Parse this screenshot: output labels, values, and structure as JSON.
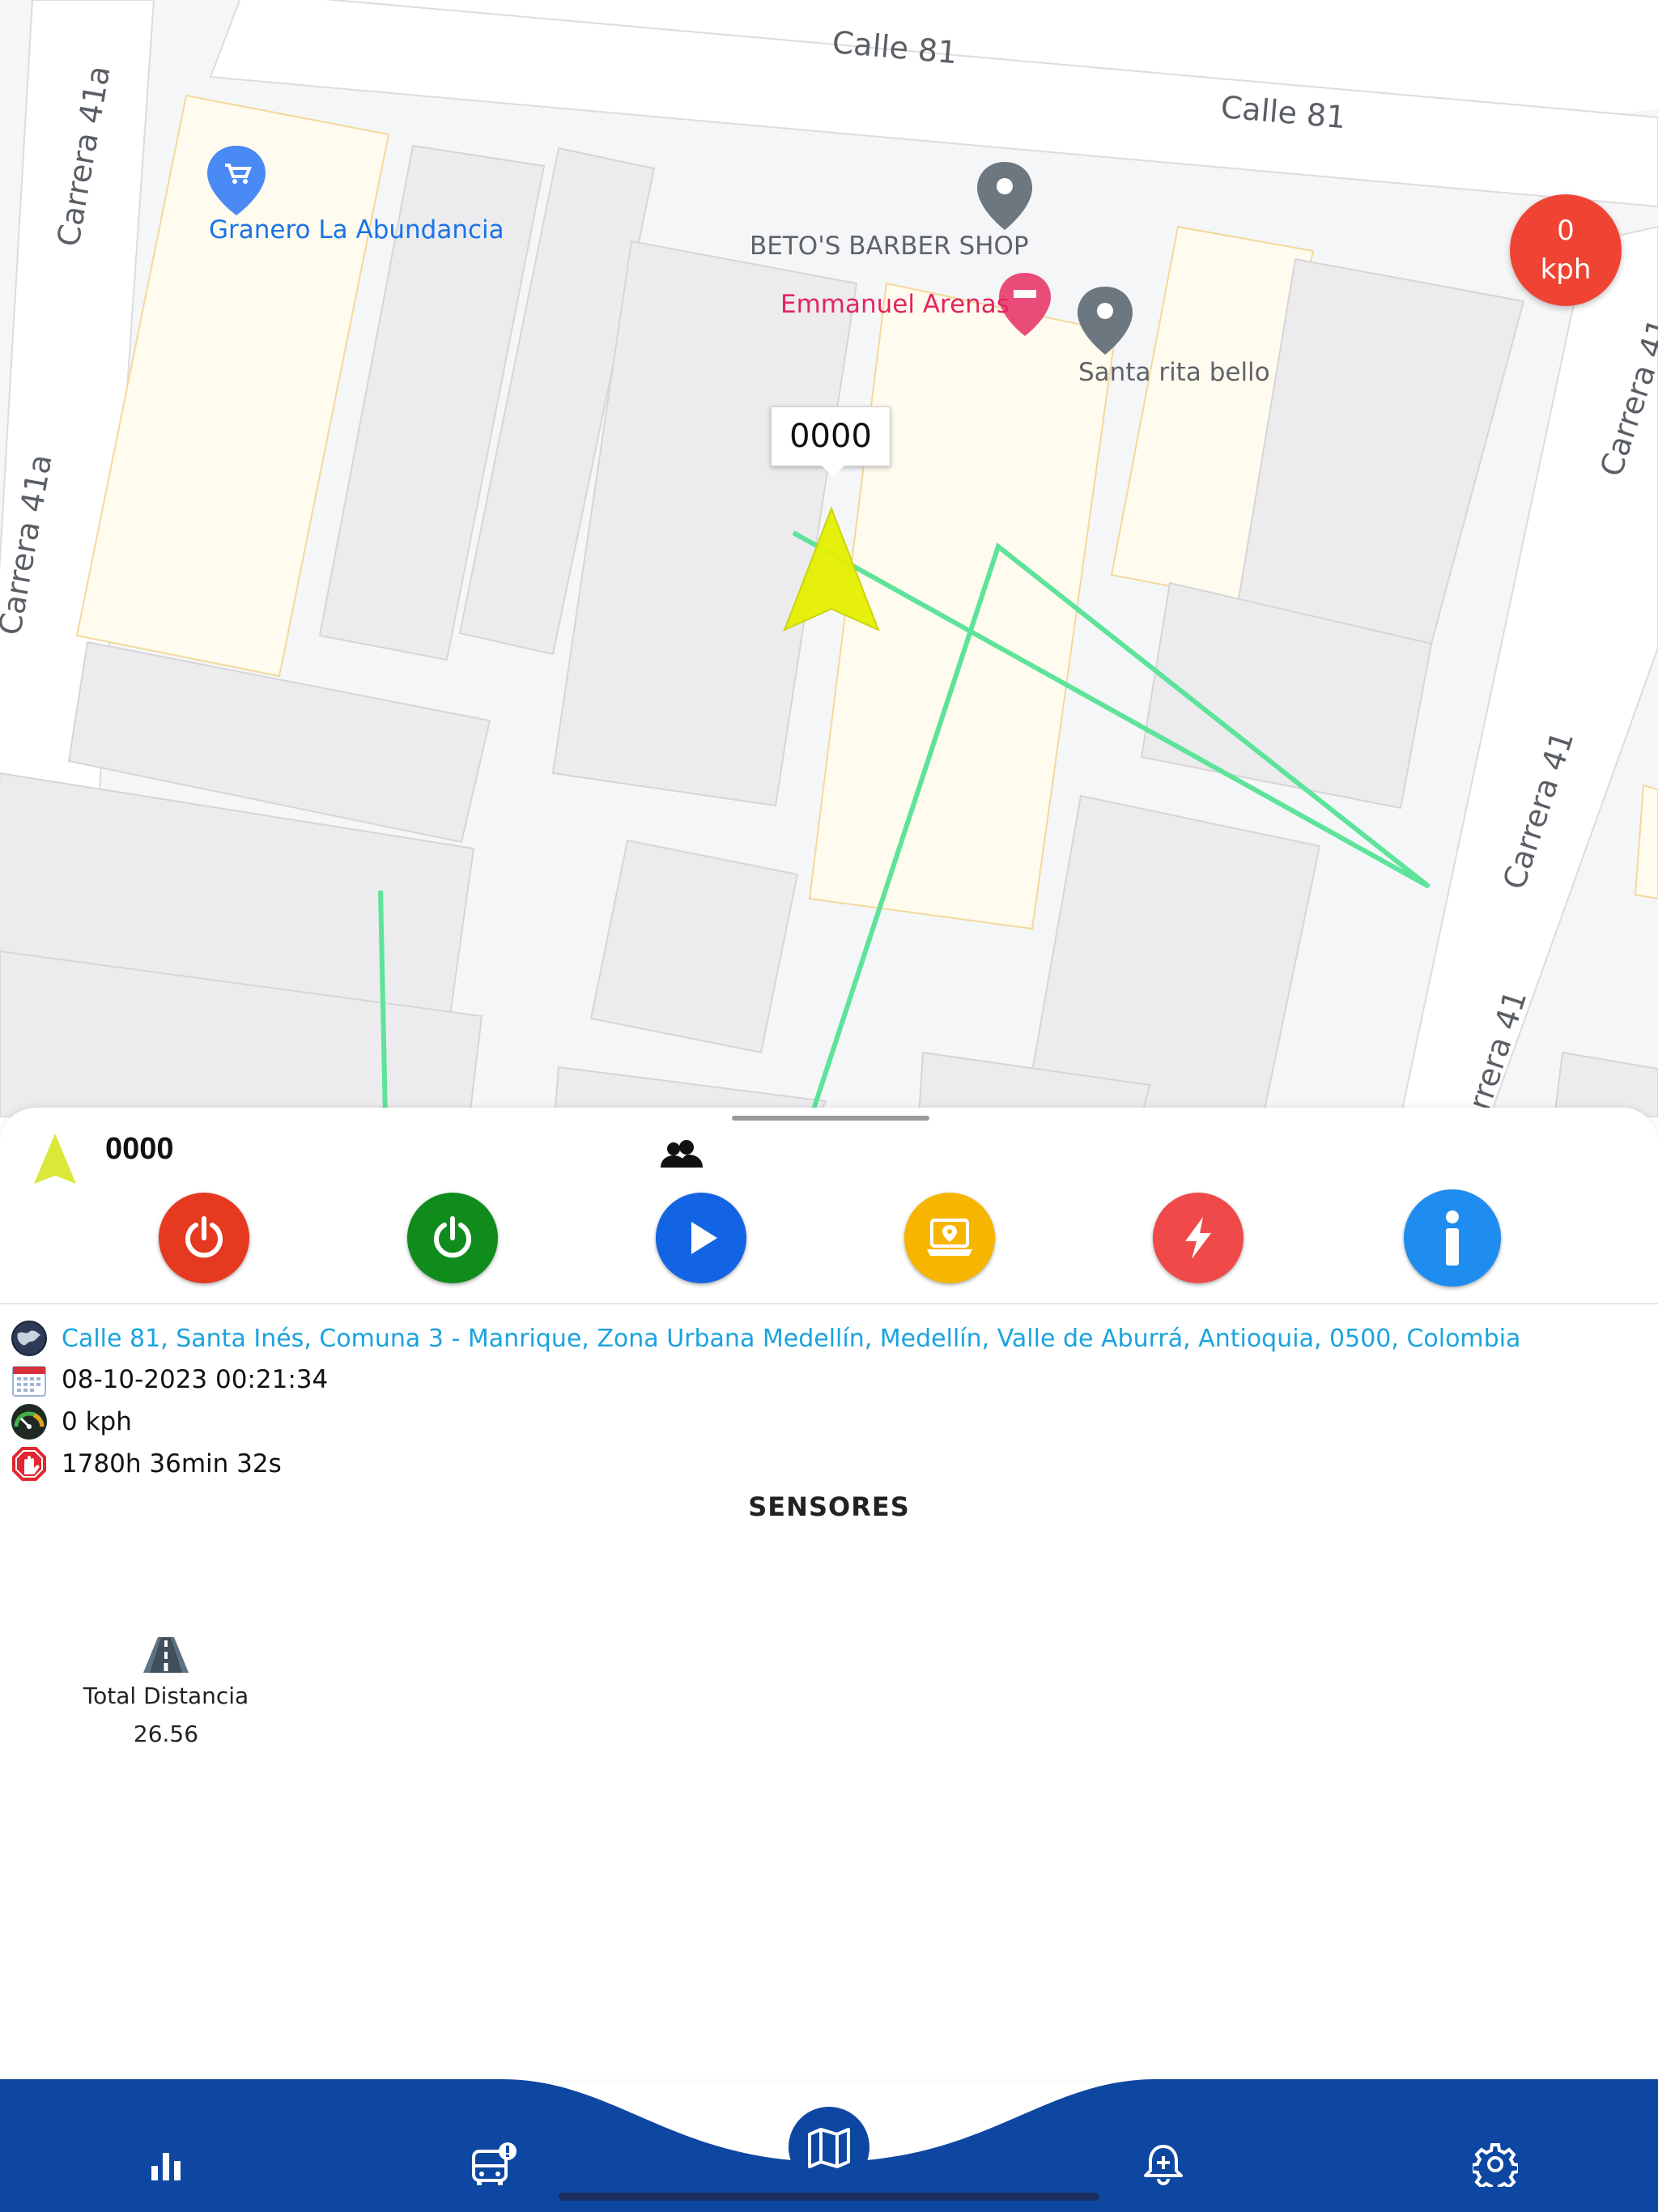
{
  "map": {
    "streets": [
      "Calle 81",
      "Calle 81",
      "Carrera 41a",
      "Carrera 41a",
      "Carrera 41",
      "Carrera 41",
      "Carrera 41"
    ],
    "pois": [
      {
        "name": "Granero La Abundancia",
        "icon": "shopping-cart-pin-icon",
        "color": "#1a73e8"
      },
      {
        "name": "BETO'S BARBER SHOP",
        "icon": "map-pin-icon",
        "color": "#5f6368"
      },
      {
        "name": "Emmanuel Arenas",
        "icon": "hotel-pin-icon",
        "color": "#e91e63"
      },
      {
        "name": "Santa rita bello",
        "icon": "map-pin-icon",
        "color": "#5f6368"
      }
    ],
    "vehicle_tooltip": "0000",
    "route_color": "#5ee39a",
    "vehicle_color": "#e6f000"
  },
  "speed_badge": {
    "value": "0",
    "unit": "kph"
  },
  "sheet": {
    "vehicle_name": "0000",
    "actions": [
      {
        "name": "engine-off",
        "color": "#e53920"
      },
      {
        "name": "engine-on",
        "color": "#0f8c1c"
      },
      {
        "name": "play-route",
        "color": "#1264e3"
      },
      {
        "name": "location-laptop",
        "color": "#f7b500"
      },
      {
        "name": "power-alert",
        "color": "#f0494a"
      },
      {
        "name": "info",
        "color": "#1f8cf0"
      }
    ],
    "address": "Calle 81, Santa Inés, Comuna 3 - Manrique, Zona Urbana Medellín, Medellín, Valle de Aburrá, Antioquia, 0500, Colombia",
    "datetime": "08-10-2023 00:21:34",
    "speed": "0 kph",
    "stop_time": "1780h 36min 32s",
    "sensors_title": "SENSORES",
    "sensors": [
      {
        "label": "Total Distancia",
        "value": "26.56"
      }
    ]
  },
  "nav": {
    "items": [
      "stats-icon",
      "bus-alert-icon",
      "map-icon",
      "bell-plus-icon",
      "settings-icon"
    ],
    "active": "map-icon",
    "color": "#0d47a1"
  }
}
